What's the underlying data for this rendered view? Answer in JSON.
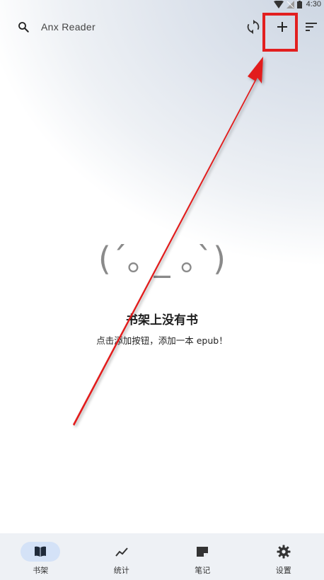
{
  "status_bar": {
    "time": "4:30"
  },
  "search": {
    "placeholder": "Anx Reader"
  },
  "toolbar": {
    "sync_icon": "sync-icon",
    "add_icon": "plus-icon",
    "sort_icon": "sort-icon"
  },
  "empty_state": {
    "kaomoji": "(´｡ _ ｡`)",
    "title": "书架上没有书",
    "subtitle": "点击添加按钮，添加一本 epub！"
  },
  "nav": {
    "items": [
      {
        "label": "书架",
        "icon": "book-icon",
        "active": true
      },
      {
        "label": "统计",
        "icon": "chart-icon",
        "active": false
      },
      {
        "label": "笔记",
        "icon": "note-icon",
        "active": false
      },
      {
        "label": "设置",
        "icon": "gear-icon",
        "active": false
      }
    ]
  },
  "annotation": {
    "color": "#e21f1f"
  }
}
